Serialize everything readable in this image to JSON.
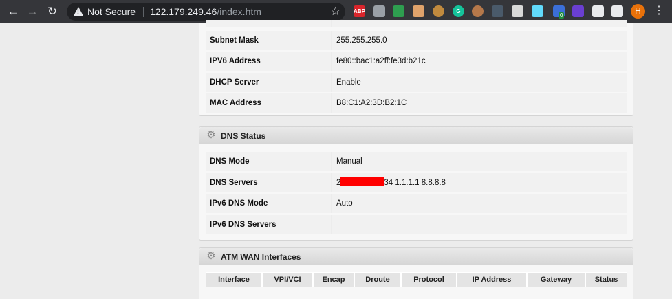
{
  "browser": {
    "security_label": "Not Secure",
    "url_host": "122.179.249.46",
    "url_path": "/index.htm",
    "extensions": [
      {
        "name": "adblock-plus-icon",
        "text": "ABP",
        "color": "#d9252b"
      },
      {
        "name": "extension-gray-icon",
        "text": "",
        "color": "#9aa0a6"
      },
      {
        "name": "shield-green-icon",
        "text": "",
        "color": "#2e9e4f"
      },
      {
        "name": "face-icon",
        "text": "",
        "color": "#e0a36b"
      },
      {
        "name": "cookie-icon",
        "text": "",
        "color": "#c08a3e"
      },
      {
        "name": "grammarly-icon",
        "text": "G",
        "color": "#15c39a"
      },
      {
        "name": "cookie-editor-icon",
        "text": "",
        "color": "#b5784a"
      },
      {
        "name": "terminal-icon",
        "text": "",
        "color": "#4a5a6a"
      },
      {
        "name": "clipboard-icon",
        "text": "",
        "color": "#d8d8d8"
      },
      {
        "name": "react-icon",
        "text": "",
        "color": "#61dafb"
      },
      {
        "name": "wappalyzer-icon",
        "text": "",
        "color": "#3b6fd8"
      },
      {
        "name": "purple-gem-icon",
        "text": "",
        "color": "#6a3fd1"
      },
      {
        "name": "camera-icon",
        "text": "",
        "color": "#e8eaed"
      },
      {
        "name": "puzzle-icon",
        "text": "",
        "color": "#e8eaed"
      }
    ],
    "badge_count": "0",
    "avatar_letter": "H"
  },
  "lan": {
    "rows": [
      {
        "label": "Subnet Mask",
        "value": "255.255.255.0"
      },
      {
        "label": "IPV6 Address",
        "value": "fe80::bac1:a2ff:fe3d:b21c"
      },
      {
        "label": "DHCP Server",
        "value": "Enable"
      },
      {
        "label": "MAC Address",
        "value": "B8:C1:A2:3D:B2:1C"
      }
    ]
  },
  "dns": {
    "title": "DNS Status",
    "rows": [
      {
        "label": "DNS Mode",
        "value": "Manual"
      },
      {
        "label": "DNS Servers",
        "value_prefix": "2",
        "value_suffix": "34 1.1.1.1 8.8.8.8"
      },
      {
        "label": "IPv6 DNS Mode",
        "value": "Auto"
      },
      {
        "label": "IPv6 DNS Servers",
        "value": ""
      }
    ]
  },
  "atm": {
    "title": "ATM WAN Interfaces",
    "columns": [
      "Interface",
      "VPI/VCI",
      "Encap",
      "Droute",
      "Protocol",
      "IP Address",
      "Gateway",
      "Status"
    ]
  }
}
